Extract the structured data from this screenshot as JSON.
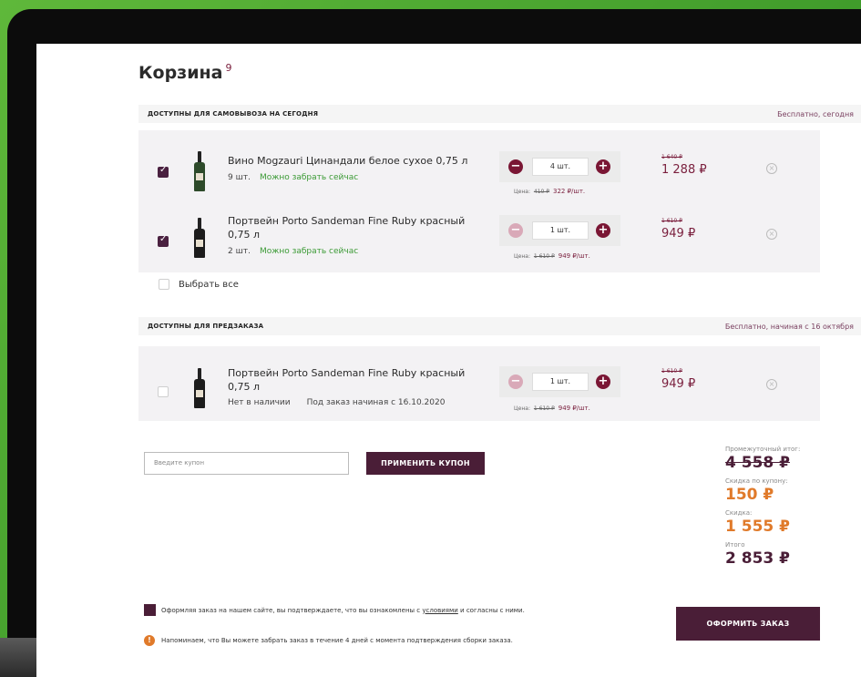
{
  "page": {
    "title": "Корзина",
    "count": "9"
  },
  "sections": [
    {
      "title": "ДОСТУПНЫ ДЛЯ САМОВЫВОЗА НА СЕГОДНЯ",
      "note": "Бесплатно, сегодня"
    },
    {
      "title": "ДОСТУПНЫ ДЛЯ ПРЕДЗАКАЗА",
      "note": "Бесплатно, начиная с 16 октября"
    }
  ],
  "pickup_items": [
    {
      "name": "Вино Mogzauri Цинандали белое сухое 0,75 л",
      "qty_text": "9 шт.",
      "status": "Можно забрать сейчас",
      "qty_input": "4 шт.",
      "price_label": "Цена:",
      "price_old_unit": "410 ₽",
      "price_unit": "322 ₽/шт.",
      "old_total": "1 640 ₽",
      "total": "1 288 ₽",
      "checked": true
    },
    {
      "name": "Портвейн Porto Sandeman Fine Ruby красный 0,75 л",
      "qty_text": "2 шт.",
      "status": "Можно забрать сейчас",
      "qty_input": "1 шт.",
      "price_label": "Цена:",
      "price_old_unit": "1 610 ₽",
      "price_unit": "949 ₽/шт.",
      "old_total": "1 610 ₽",
      "total": "949 ₽",
      "checked": true
    }
  ],
  "select_all": "Выбрать все",
  "preorder_items": [
    {
      "name": "Портвейн Porto Sandeman Fine Ruby красный 0,75 л",
      "qty_text": "Нет в наличии",
      "status": "Под заказ начиная с 16.10.2020",
      "qty_input": "1 шт.",
      "price_label": "Цена:",
      "price_old_unit": "1 610 ₽",
      "price_unit": "949 ₽/шт.",
      "old_total": "1 610 ₽",
      "total": "949 ₽",
      "checked": false
    }
  ],
  "coupon": {
    "placeholder": "Введите купон",
    "button": "ПРИМЕНИТЬ КУПОН"
  },
  "totals": {
    "subtotal_label": "Промежуточный итог:",
    "subtotal": "4 558 ₽",
    "coupon_label": "Скидка по купону:",
    "coupon": "150 ₽",
    "discount_label": "Скидка:",
    "discount": "1 555 ₽",
    "total_label": "Итого",
    "total": "2 853 ₽"
  },
  "agree": {
    "before": "Оформляя заказ на нашем сайте, вы подтверждаете, что вы ознакомлены с ",
    "link": "условиями",
    "after": " и согласны с ними."
  },
  "remind": "Напоминаем, что Вы можете забрать заказ в течение 4 дней с момента подтверждения сборки заказа.",
  "order_button": "ОФОРМИТЬ ЗАКАЗ",
  "colors": {
    "brand": "#4a1e37",
    "accent_orange": "#e07a2a",
    "green": "#3b9a35",
    "bg_green": "#4caa30"
  },
  "icons": {
    "plus": "plus-icon",
    "minus": "minus-icon",
    "remove": "close-circle-icon",
    "info": "info-icon"
  }
}
